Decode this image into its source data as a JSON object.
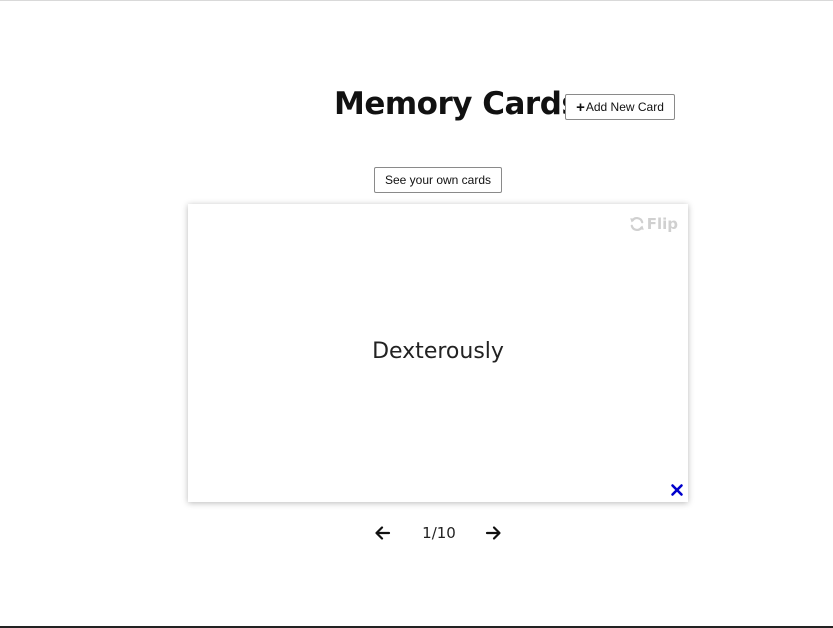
{
  "header": {
    "title": "Memory Cards",
    "add_button_label": "Add New Card",
    "add_button_icon": "plus-icon"
  },
  "own_cards_button_label": "See your own cards",
  "card": {
    "word": "Dexterously",
    "flip_label": "Flip",
    "flip_icon": "refresh-icon",
    "delete_icon": "close-icon",
    "delete_icon_color": "#0000cc",
    "flip_color": "#d0d0d0"
  },
  "pagination": {
    "current": 1,
    "total": 10,
    "label": "1/10",
    "prev_icon": "arrow-left-icon",
    "next_icon": "arrow-right-icon"
  }
}
